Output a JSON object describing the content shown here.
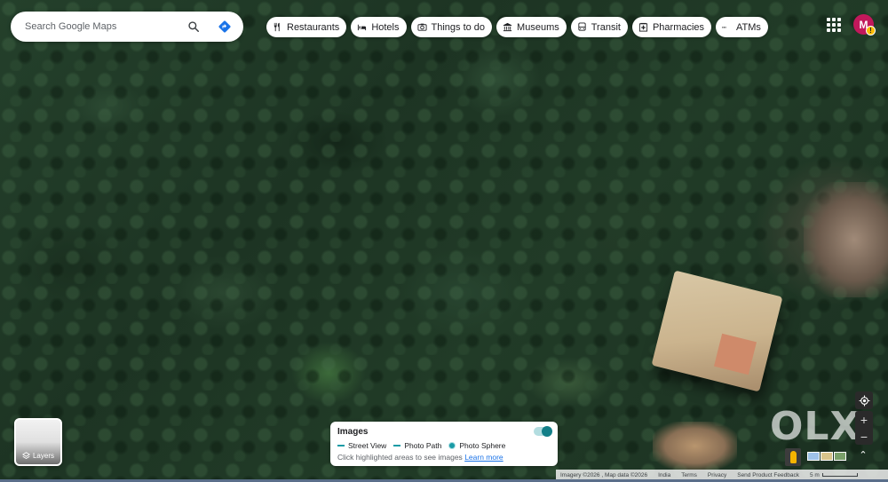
{
  "search": {
    "placeholder": "Search Google Maps"
  },
  "chips": [
    {
      "label": "Restaurants",
      "icon": "fork-knife-icon"
    },
    {
      "label": "Hotels",
      "icon": "bed-icon"
    },
    {
      "label": "Things to do",
      "icon": "camera-icon"
    },
    {
      "label": "Museums",
      "icon": "museum-icon"
    },
    {
      "label": "Transit",
      "icon": "bus-icon"
    },
    {
      "label": "Pharmacies",
      "icon": "pharmacy-icon"
    },
    {
      "label": "ATMs",
      "icon": "atm-icon"
    }
  ],
  "account": {
    "initial": "M",
    "badge": "!"
  },
  "layers": {
    "label": "Layers"
  },
  "images_panel": {
    "title": "Images",
    "legend": [
      "Street View",
      "Photo Path",
      "Photo Sphere"
    ],
    "hint": "Click highlighted areas to see images",
    "learn_more": "Learn more",
    "enabled": true
  },
  "zoom": {
    "in": "+",
    "out": "−"
  },
  "watermark": "OLX",
  "footer": {
    "imagery": "Imagery ©2026 , Map data ©2026",
    "country": "India",
    "terms": "Terms",
    "privacy": "Privacy",
    "feedback": "Send Product Feedback",
    "scale": "5 m"
  },
  "colors": {
    "accent_teal": "#1a9ba6",
    "avatar": "#c2185b",
    "link": "#1a73e8",
    "direction": "#1a73e8"
  }
}
